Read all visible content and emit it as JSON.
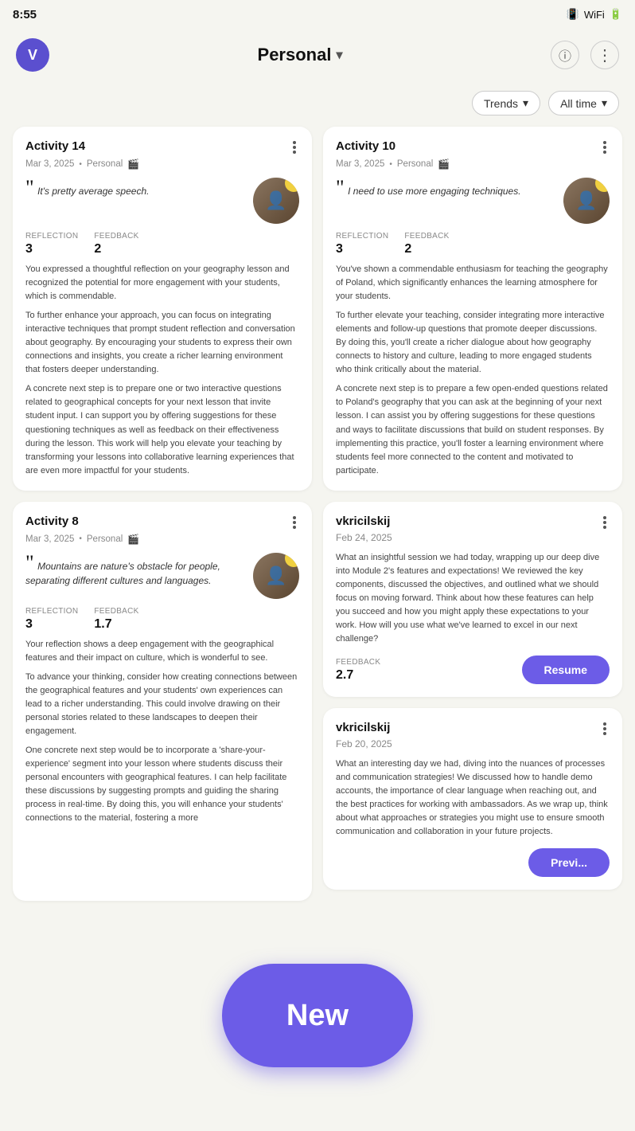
{
  "statusBar": {
    "time": "8:55"
  },
  "header": {
    "avatar": "V",
    "title": "Personal",
    "infoLabel": "info",
    "moreLabel": "more"
  },
  "filters": {
    "trends": "Trends",
    "allTime": "All time"
  },
  "activity14": {
    "title": "Activity 14",
    "date": "Mar 3, 2025",
    "context": "Personal",
    "quote": "It's pretty average speech.",
    "reflectionLabel": "REFLECTION",
    "feedbackLabel": "FEEDBACK",
    "reflection": "3",
    "feedback": "2",
    "body": [
      "You expressed a thoughtful reflection on your geography lesson and recognized the potential for more engagement with your students, which is commendable.",
      "To further enhance your approach, you can focus on integrating interactive techniques that prompt student reflection and conversation about geography. By encouraging your students to express their own connections and insights, you create a richer learning environment that fosters deeper understanding.",
      "A concrete next step is to prepare one or two interactive questions related to geographical concepts for your next lesson that invite student input. I can support you by offering suggestions for these questioning techniques as well as feedback on their effectiveness during the lesson. This work will help you elevate your teaching by transforming your lessons into collaborative learning experiences that are even more impactful for your students."
    ]
  },
  "activity10": {
    "title": "Activity 10",
    "date": "Mar 3, 2025",
    "context": "Personal",
    "quote": "I need to use more engaging techniques.",
    "reflectionLabel": "REFLECTION",
    "feedbackLabel": "FEEDBACK",
    "reflection": "3",
    "feedback": "2",
    "body": [
      "You've shown a commendable enthusiasm for teaching the geography of Poland, which significantly enhances the learning atmosphere for your students.",
      "To further elevate your teaching, consider integrating more interactive elements and follow-up questions that promote deeper discussions. By doing this, you'll create a richer dialogue about how geography connects to history and culture, leading to more engaged students who think critically about the material.",
      "A concrete next step is to prepare a few open-ended questions related to Poland's geography that you can ask at the beginning of your next lesson. I can assist you by offering suggestions for these questions and ways to facilitate discussions that build on student responses. By implementing this practice, you'll foster a learning environment where students feel more connected to the content and motivated to participate."
    ]
  },
  "activity8": {
    "title": "Activity 8",
    "date": "Mar 3, 2025",
    "context": "Personal",
    "quote": "Mountains are nature's obstacle for people, separating different cultures and languages.",
    "reflectionLabel": "REFLECTION",
    "feedbackLabel": "FEEDBACK",
    "reflection": "3",
    "feedback": "1.7",
    "body": [
      "Your reflection shows a deep engagement with the geographical features and their impact on culture, which is wonderful to see.",
      "To advance your thinking, consider how creating connections between the geographical features and your students' own experiences can lead to a richer understanding. This could involve drawing on their personal stories related to these landscapes to deepen their engagement.",
      "One concrete next step would be to incorporate a 'share-your-experience' segment into your lesson where students discuss their personal encounters with geographical features. I can help facilitate these discussions by suggesting prompts and guiding the sharing process in real-time. By doing this, you will enhance your students' connections to the material, fostering a more"
    ]
  },
  "session1": {
    "author": "vkricilskij",
    "date": "Feb 24, 2025",
    "body": "What an insightful session we had today, wrapping up our deep dive into Module 2's features and expectations! We reviewed the key components, discussed the objectives, and outlined what we should focus on moving forward. Think about how these features can help you succeed and how you might apply these expectations to your work. How will you use what we've learned to excel in our next challenge?",
    "feedbackLabel": "FEEDBACK",
    "feedback": "2.7",
    "resumeLabel": "Resume"
  },
  "session2": {
    "author": "vkricilskij",
    "date": "Feb 20, 2025",
    "body": "What an interesting day we had, diving into the nuances of processes and communication strategies! We discussed how to handle demo accounts, the importance of clear language when reaching out, and the best practices for working with ambassadors. As we wrap up, think about what approaches or strategies you might use to ensure smooth communication and collaboration in your future projects.",
    "resumeLabel": "Previ..."
  },
  "fab": {
    "label": "New"
  }
}
